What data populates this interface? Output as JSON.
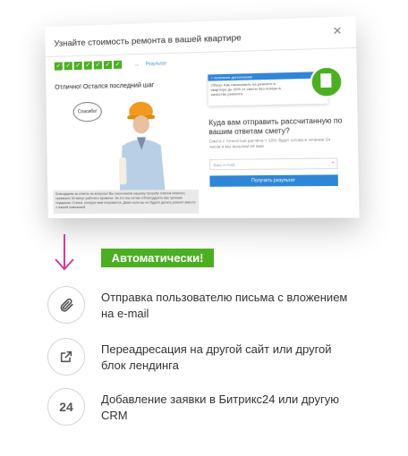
{
  "popup": {
    "title": "Узнайте стоимость ремонта в вашей квартире",
    "close_icon": "close-icon",
    "steps": [
      "✓",
      "✓",
      "✓",
      "✓",
      "✓",
      "✓",
      "✓"
    ],
    "result_label": "Результат",
    "left_heading": "Отлично! Остался последний шаг",
    "bubble_text": "Спасибо!",
    "caption": "Благодарим за ответы на вопросы! Вы сэкономили нашему прорабу совсем немного, примерно 30 минут рабочего времени. За это мы хотим отблагодарить вас ценным подарком. Статья, которую вам понравится. Даже если вы не будете делать ремонт вместе с нашей компанией.",
    "info_head": "+ полезное дополнение",
    "info_text": "Обзор: Как сэкономить на ремонте в квартире до 20% от сметы без потерь в качестве ремонта.",
    "question": "Куда вам отправить рассчитанную по вашим ответам смету?",
    "question_sub": "Смета с точностью расчёта + 10% будет готова в течение 24 часов и мы вышлем её вам",
    "email_placeholder": "Ваш e-mail",
    "submit_label": "Получить результат"
  },
  "badge": "Автоматически!",
  "features": [
    {
      "icon": "paperclip-icon",
      "text": "Отправка пользователю письма с вложением на e-mail"
    },
    {
      "icon": "external-link-icon",
      "text": "Переадресация на другой сайт или другой блок лендинга"
    },
    {
      "icon": "bitrix24-icon",
      "icon_text": "24",
      "text": "Добавление заявки в Битрикс24 или другую CRM"
    }
  ],
  "colors": {
    "accent_green": "#4caf22",
    "accent_blue": "#2f86d6",
    "arrow_magenta": "#d63a9a"
  }
}
